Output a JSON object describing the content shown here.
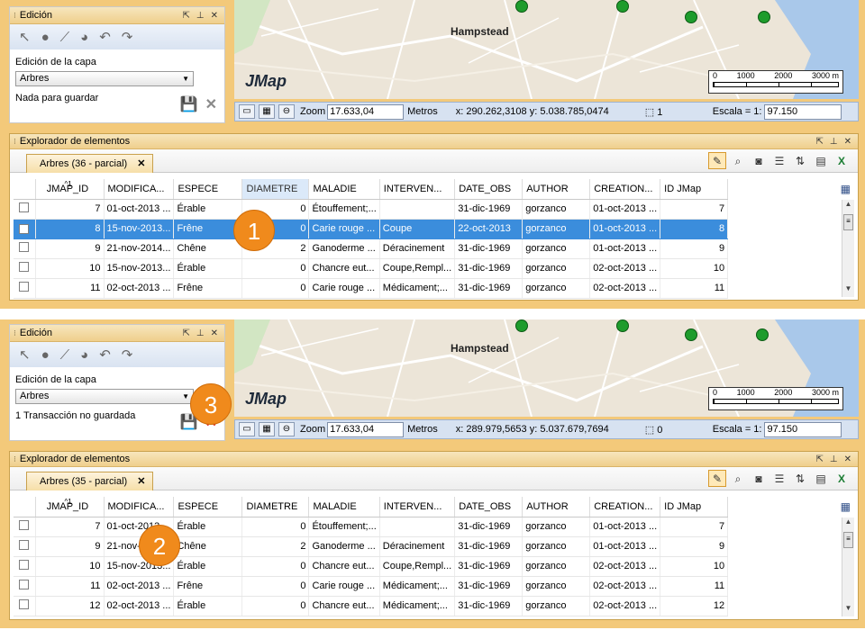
{
  "colors": {
    "accent": "#f08a1c",
    "selection": "#3b8ddc",
    "panel_header": "#efcf8c",
    "tree": "#1e9c2c"
  },
  "icons": [
    "select-arrow-icon",
    "point-icon",
    "line-icon",
    "polygon-icon",
    "undo-icon",
    "redo-icon",
    "save-icon",
    "close-icon",
    "zoom-extent-icon",
    "layers-icon",
    "measure-icon",
    "selection-icon",
    "edit-pencil-icon",
    "search-icon",
    "theme-icon",
    "list-icon",
    "sort-icon",
    "table-icon",
    "excel-icon",
    "grid-menu-icon",
    "tree-icon"
  ],
  "top": {
    "edit_panel": {
      "title": "Edición",
      "layer_label": "Edición de la capa",
      "layer_value": "Arbres",
      "status": "Nada para guardar"
    },
    "map": {
      "place": "Hampstead",
      "logo": "JMap",
      "scale_labels": [
        "0",
        "1000",
        "2000",
        "3000 m"
      ]
    },
    "status_bar": {
      "zoom_label": "Zoom",
      "zoom_value": "17.633,04",
      "units": "Metros",
      "coords": "x: 290.262,3108  y: 5.038.785,0474",
      "selected": "1",
      "scale_label": "Escala = 1:",
      "scale_value": "97.150"
    },
    "explorer": {
      "title": "Explorador de elementos",
      "tab_label": "Arbres (36 - parcial)",
      "tab_close": "✕",
      "sort_index": "1",
      "columns": [
        "",
        "JMAP_ID",
        "MODIFICA...",
        "ESPECE",
        "DIAMETRE",
        "MALADIE",
        "INTERVEN...",
        "DATE_OBS",
        "AUTHOR",
        "CREATION...",
        "ID JMap"
      ],
      "rows": [
        {
          "checked": false,
          "selected": false,
          "cells": [
            "7",
            "01-oct-2013 ...",
            "Érable",
            "0",
            "Étouffement;...",
            "",
            "31-dic-1969",
            "gorzanco",
            "01-oct-2013 ...",
            "7"
          ]
        },
        {
          "checked": true,
          "selected": true,
          "cells": [
            "8",
            "15-nov-2013...",
            "Frêne",
            "0",
            "Carie rouge ...",
            "Coupe",
            "22-oct-2013",
            "gorzanco",
            "01-oct-2013 ...",
            "8"
          ]
        },
        {
          "checked": false,
          "selected": false,
          "cells": [
            "9",
            "21-nov-2014...",
            "Chêne",
            "2",
            "Ganoderme ...",
            "Déracinement",
            "31-dic-1969",
            "gorzanco",
            "01-oct-2013 ...",
            "9"
          ]
        },
        {
          "checked": false,
          "selected": false,
          "cells": [
            "10",
            "15-nov-2013...",
            "Érable",
            "0",
            "Chancre eut...",
            "Coupe,Rempl...",
            "31-dic-1969",
            "gorzanco",
            "02-oct-2013 ...",
            "10"
          ]
        },
        {
          "checked": false,
          "selected": false,
          "cells": [
            "11",
            "02-oct-2013 ...",
            "Frêne",
            "0",
            "Carie rouge ...",
            "Médicament;...",
            "31-dic-1969",
            "gorzanco",
            "02-oct-2013 ...",
            "11"
          ]
        }
      ]
    },
    "marker": "1"
  },
  "bottom": {
    "edit_panel": {
      "title": "Edición",
      "layer_label": "Edición de la capa",
      "layer_value": "Arbres",
      "status": "1 Transacción no guardada"
    },
    "map": {
      "place": "Hampstead",
      "logo": "JMap",
      "scale_labels": [
        "0",
        "1000",
        "2000",
        "3000 m"
      ]
    },
    "status_bar": {
      "zoom_label": "Zoom",
      "zoom_value": "17.633,04",
      "units": "Metros",
      "coords": "x: 289.979,5653  y: 5.037.679,7694",
      "selected": "0",
      "scale_label": "Escala = 1:",
      "scale_value": "97.150"
    },
    "explorer": {
      "title": "Explorador de elementos",
      "tab_label": "Arbres (35 - parcial)",
      "tab_close": "✕",
      "sort_index": "1",
      "columns": [
        "",
        "JMAP_ID",
        "MODIFICA...",
        "ESPECE",
        "DIAMETRE",
        "MALADIE",
        "INTERVEN...",
        "DATE_OBS",
        "AUTHOR",
        "CREATION...",
        "ID JMap"
      ],
      "rows": [
        {
          "checked": false,
          "selected": false,
          "cells": [
            "7",
            "01-oct-2013 ...",
            "Érable",
            "0",
            "Étouffement;...",
            "",
            "31-dic-1969",
            "gorzanco",
            "01-oct-2013 ...",
            "7"
          ]
        },
        {
          "checked": false,
          "selected": false,
          "cells": [
            "9",
            "21-nov-2014...",
            "Chêne",
            "2",
            "Ganoderme ...",
            "Déracinement",
            "31-dic-1969",
            "gorzanco",
            "01-oct-2013 ...",
            "9"
          ]
        },
        {
          "checked": false,
          "selected": false,
          "cells": [
            "10",
            "15-nov-2013...",
            "Érable",
            "0",
            "Chancre eut...",
            "Coupe,Rempl...",
            "31-dic-1969",
            "gorzanco",
            "02-oct-2013 ...",
            "10"
          ]
        },
        {
          "checked": false,
          "selected": false,
          "cells": [
            "11",
            "02-oct-2013 ...",
            "Frêne",
            "0",
            "Carie rouge ...",
            "Médicament;...",
            "31-dic-1969",
            "gorzanco",
            "02-oct-2013 ...",
            "11"
          ]
        },
        {
          "checked": false,
          "selected": false,
          "cells": [
            "12",
            "02-oct-2013 ...",
            "Érable",
            "0",
            "Chancre eut...",
            "Médicament;...",
            "31-dic-1969",
            "gorzanco",
            "02-oct-2013 ...",
            "12"
          ]
        }
      ]
    },
    "marker_2": "2",
    "marker_3": "3"
  }
}
